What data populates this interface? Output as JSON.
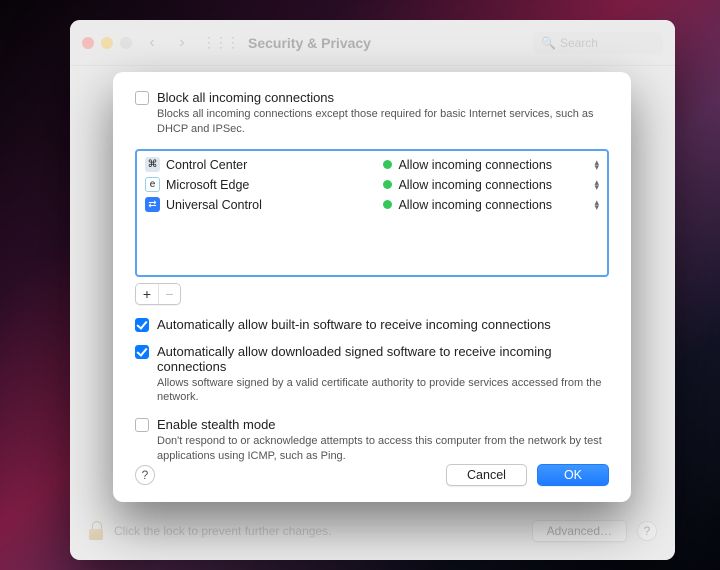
{
  "window": {
    "title": "Security & Privacy",
    "search_placeholder": "Search",
    "lock_text": "Click the lock to prevent further changes.",
    "advanced_label": "Advanced…"
  },
  "sheet": {
    "block_all": {
      "checked": false,
      "label": "Block all incoming connections",
      "desc": "Blocks all incoming connections except those required for basic Internet services, such as DHCP and IPSec."
    },
    "apps": [
      {
        "icon": "cc",
        "name": "Control Center",
        "status": "Allow incoming connections"
      },
      {
        "icon": "ed",
        "name": "Microsoft Edge",
        "status": "Allow incoming connections"
      },
      {
        "icon": "uc",
        "name": "Universal Control",
        "status": "Allow incoming connections"
      }
    ],
    "add_label": "+",
    "remove_label": "−",
    "auto_builtin": {
      "checked": true,
      "label": "Automatically allow built-in software to receive incoming connections"
    },
    "auto_signed": {
      "checked": true,
      "label": "Automatically allow downloaded signed software to receive incoming connections",
      "desc": "Allows software signed by a valid certificate authority to provide services accessed from the network."
    },
    "stealth": {
      "checked": false,
      "label": "Enable stealth mode",
      "desc": "Don't respond to or acknowledge attempts to access this computer from the network by test applications using ICMP, such as Ping."
    },
    "help_label": "?",
    "cancel_label": "Cancel",
    "ok_label": "OK"
  }
}
